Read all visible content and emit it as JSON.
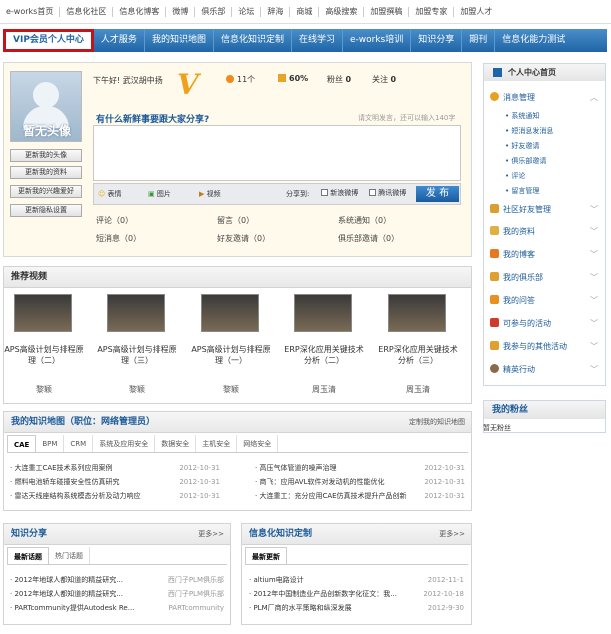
{
  "topnav": [
    "e-works首页",
    "信息化社区",
    "信息化博客",
    "微博",
    "俱乐部",
    "论坛",
    "辞海",
    "商城",
    "高级搜索",
    "加盟撰稿",
    "加盟专家",
    "加盟人才"
  ],
  "mainnav": [
    "VIP会员个人中心",
    "人才服务",
    "我的知识地图",
    "信息化知识定制",
    "在线学习",
    "e-works培训",
    "知识分享",
    "期刊",
    "信息化能力测试"
  ],
  "profile": {
    "greeting": "下午好! 武汉胡中扬",
    "v": "V",
    "points": "11个",
    "percent": "60%",
    "fans_label": "粉丝",
    "fans": "0",
    "follow_label": "关注",
    "follow": "0",
    "avatar_text": "暂无头像",
    "btns": [
      "更新我的头像",
      "更新我的资料",
      "更新我的兴趣爱好",
      "更新隐私设置"
    ],
    "question": "有什么新鲜事要跟大家分享?",
    "hint": "请文明发言，还可以输入140字",
    "tools": [
      "表情",
      "图片",
      "视频"
    ],
    "share_label": "分享到:",
    "share_opts": [
      "新浪微博",
      "腾讯微博"
    ],
    "publish": "发 布",
    "stats": [
      [
        "评论（0）",
        "留言（0）",
        "系统通知（0）"
      ],
      [
        "短消息（0）",
        "好友邀请（0）",
        "俱乐部邀请（0）"
      ]
    ]
  },
  "videos": {
    "title": "推荐视频",
    "items": [
      {
        "t": "APS高级计划与排程原理（二）",
        "a": "黎颖"
      },
      {
        "t": "APS高级计划与排程原理（三）",
        "a": "黎颖"
      },
      {
        "t": "APS高级计划与排程原理（一）",
        "a": "黎颖"
      },
      {
        "t": "ERP深化应用关键技术分析（二）",
        "a": "周玉清"
      },
      {
        "t": "ERP深化应用关键技术分析（三）",
        "a": "周玉清"
      }
    ]
  },
  "kmap": {
    "title": "我的知识地图（职位：网络管理员）",
    "custom": "定制我的知识地图",
    "tabs": [
      "CAE",
      "BPM",
      "CRM",
      "系统及应用安全",
      "数据安全",
      "主机安全",
      "网络安全"
    ],
    "left": [
      [
        "大连重工CAE技术系列应用案例",
        "2012-10-31"
      ],
      [
        "燃料电池轿车碰撞安全性仿真研究",
        "2012-10-31"
      ],
      [
        "雷达天线座结构系统模态分析及动力响应",
        "2012-10-31"
      ]
    ],
    "right": [
      [
        "高压气体管道的噪声治理",
        "2012-10-31"
      ],
      [
        "商飞：应用AVL软件对发动机的性能优化",
        "2012-10-31"
      ],
      [
        "大连重工：充分应用CAE仿真技术提升产品创新",
        "2012-10-31"
      ]
    ]
  },
  "share": {
    "title": "知识分享",
    "more": "更多>>",
    "tabs": [
      "最新话题",
      "热门话题"
    ],
    "items": [
      [
        "2012年地球人都知道的精益研究...",
        "西门子PLM俱乐部"
      ],
      [
        "2012年地球人都知道的精益研究...",
        "西门子PLM俱乐部"
      ],
      [
        "PARTcommunity提供Autodesk Re...",
        "PARTcommunity"
      ]
    ]
  },
  "custom": {
    "title": "信息化知识定制",
    "more": "更多>>",
    "tab": "最新更新",
    "items": [
      [
        "altium电路设计",
        "2012-11-1"
      ],
      [
        "2012年中国制造业产品创新数字化征文：我...",
        "2012-10-18"
      ],
      [
        "PLM厂商的水平策略和纵深发展",
        "2012-9-30"
      ]
    ]
  },
  "right": {
    "head": "个人中心首页",
    "msg": "消息管理",
    "subs": [
      "系统通知",
      "短消息发消息",
      "好友邀请",
      "俱乐部邀请",
      "评论",
      "留言管理"
    ],
    "items": [
      "社区好友管理",
      "我的资料",
      "我的博客",
      "我的俱乐部",
      "我的问答",
      "可参与的活动",
      "我参与的其他活动",
      "精英行动"
    ],
    "fans_title": "我的粉丝",
    "fans_none": "暂无粉丝"
  },
  "colors": {
    "nav": "#1f64a6",
    "red": "#c0151b",
    "title": "#1c5b99"
  }
}
